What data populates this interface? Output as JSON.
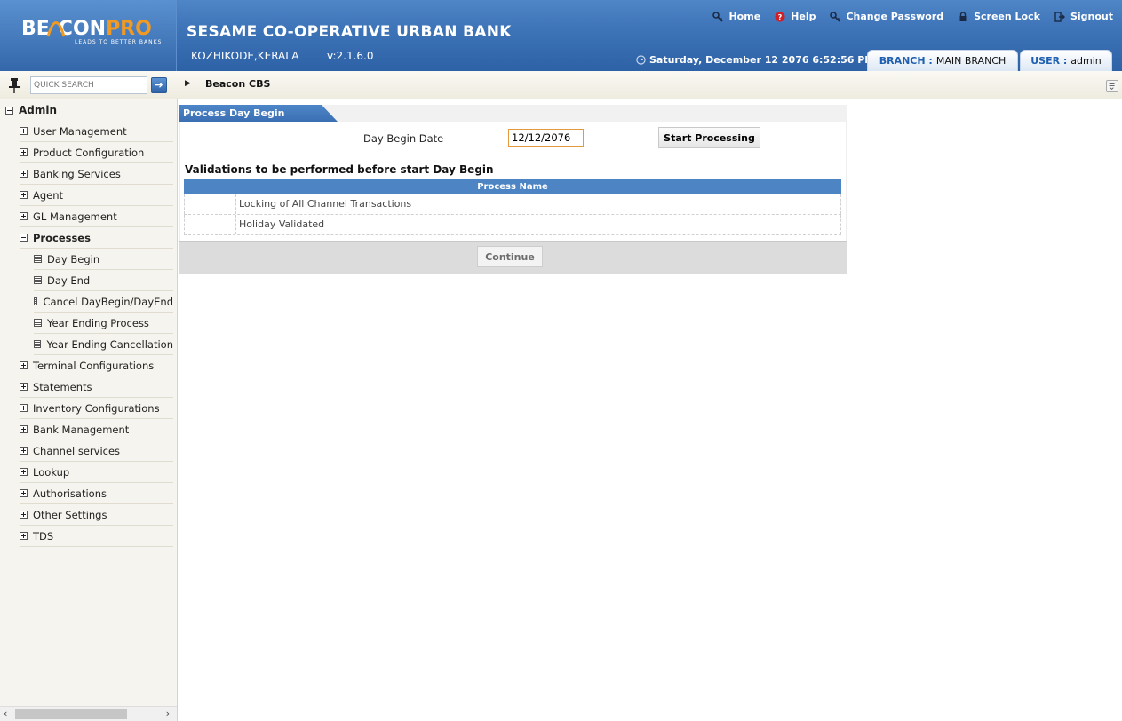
{
  "header": {
    "logo": {
      "part1": "BE",
      "part2": "CON",
      "part3": "PRO",
      "tagline": "LEADS TO BETTER BANKS"
    },
    "bank_name": "SESAME CO-OPERATIVE URBAN BANK",
    "location": "KOZHIKODE,KERALA",
    "version": "v:2.1.6.0",
    "links": [
      {
        "label": "Home",
        "icon": "key-icon"
      },
      {
        "label": "Help",
        "icon": "help-icon"
      },
      {
        "label": "Change Password",
        "icon": "key-icon"
      },
      {
        "label": "Screen Lock",
        "icon": "lock-icon"
      },
      {
        "label": "Signout",
        "icon": "signout-icon"
      }
    ],
    "datetime": "Saturday, December 12 2076  6:52:56 PM",
    "branch_key": "BRANCH :",
    "branch_value": "MAIN BRANCH",
    "user_key": "USER :",
    "user_value": "admin"
  },
  "toolbar": {
    "search_placeholder": "QUICK SEARCH",
    "breadcrumb": "Beacon CBS"
  },
  "sidebar": {
    "root": "Admin",
    "items": [
      {
        "label": "User Management"
      },
      {
        "label": "Product Configuration"
      },
      {
        "label": "Banking Services"
      },
      {
        "label": "Agent"
      },
      {
        "label": "GL Management"
      },
      {
        "label": "Processes"
      },
      {
        "label": "Terminal Configurations"
      },
      {
        "label": "Statements"
      },
      {
        "label": "Inventory Configurations"
      },
      {
        "label": "Bank Management"
      },
      {
        "label": "Channel services"
      },
      {
        "label": "Lookup"
      },
      {
        "label": "Authorisations"
      },
      {
        "label": "Other Settings"
      },
      {
        "label": "TDS"
      }
    ],
    "sub_items": [
      {
        "label": "Day Begin"
      },
      {
        "label": "Day End"
      },
      {
        "label": "Cancel DayBegin/DayEnd"
      },
      {
        "label": "Year Ending Process"
      },
      {
        "label": "Year Ending Cancellation"
      }
    ]
  },
  "main": {
    "panel_title": "Process Day Begin",
    "date_label": "Day Begin Date",
    "date_value": "12/12/2076",
    "start_button": "Start Processing",
    "validation_title": "Validations to be performed before start Day Begin",
    "grid_header": "Process Name",
    "rows": [
      {
        "name": "Locking of All Channel Transactions"
      },
      {
        "name": "Holiday Validated"
      }
    ],
    "continue_button": "Continue"
  },
  "colors": {
    "header_blue": "#3c72b6",
    "logo_orange": "#f19a23",
    "grid_header_blue": "#4c84c4",
    "date_input_border": "#e49a3c"
  }
}
